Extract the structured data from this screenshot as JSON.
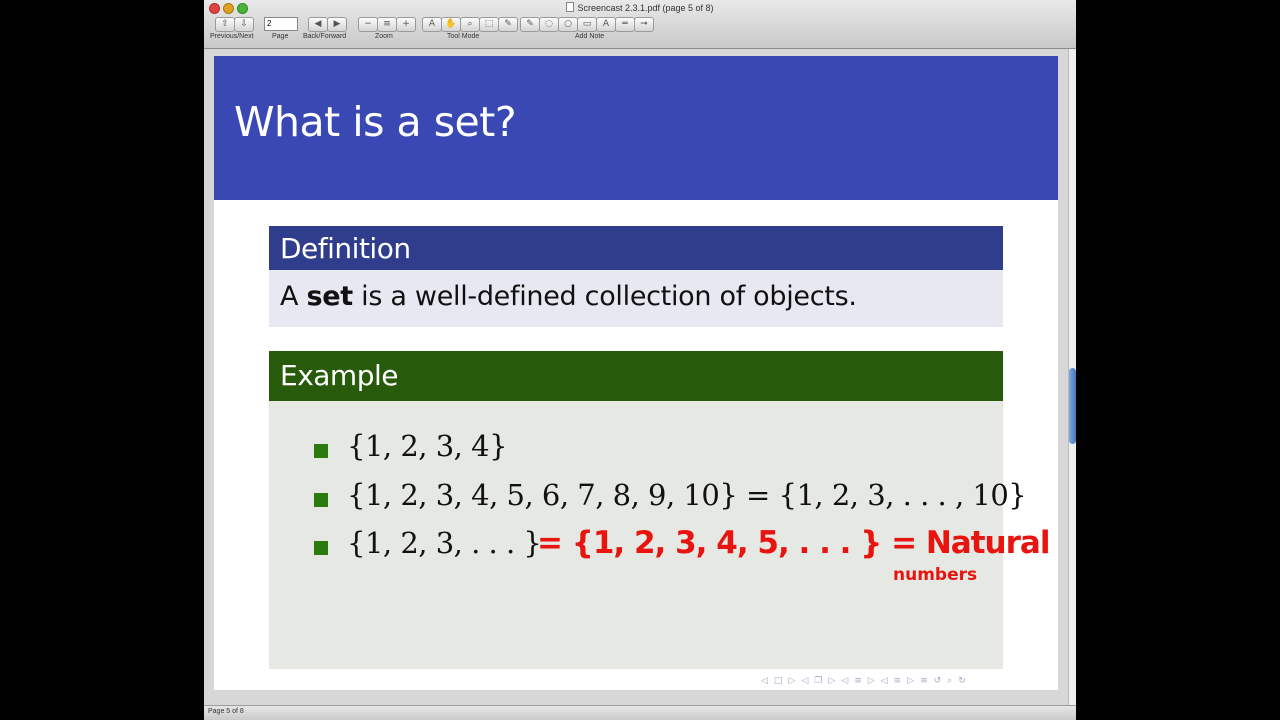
{
  "window": {
    "title": "Screencast 2.3.1.pdf (page 5 of 8)",
    "page_field": "2",
    "status": "Page 5 of 8"
  },
  "toolbar": {
    "labels": {
      "prev_next": "Previous/Next",
      "page": "Page",
      "back_forward": "Back/Forward",
      "zoom": "Zoom",
      "tool_mode": "Tool Mode",
      "add_note": "Add Note"
    },
    "icons": {
      "prev": "⇧",
      "next": "⇩",
      "back": "◀",
      "forward": "▶",
      "zoom_out": "−",
      "zoom_fit": "≡",
      "zoom_in": "+",
      "text_tool": "A",
      "move_tool": "✋",
      "zoom_tool": "⌕",
      "select_tool": "⬚",
      "pen_tool": "✎",
      "note_text": "✎",
      "note_callout": "◌",
      "note_oval": "○",
      "note_rect": "▭",
      "note_highlight": "A",
      "note_strike": "═",
      "note_arrow": "➞"
    }
  },
  "slide": {
    "title": "What is a set?",
    "definition": {
      "heading": "Definition",
      "prefix": "A ",
      "bold": "set",
      "suffix": " is a well-defined collection of objects."
    },
    "example": {
      "heading": "Example",
      "items": [
        "{1, 2, 3, 4}",
        "{1, 2, 3, 4, 5, 6, 7, 8, 9, 10} = {1, 2, 3, . . . , 10}",
        "{1, 2, 3, . . . }"
      ]
    },
    "annotation": {
      "line1": "= {1, 2, 3, 4, 5, . . . } = Natural",
      "line2": "numbers"
    },
    "nav_icons": [
      "◁",
      "□",
      "▷",
      "◁",
      "❐",
      "▷",
      "◁",
      "≡",
      "▷",
      "◁",
      "≡",
      "▷",
      "≡",
      "↺",
      "⌕",
      "↻"
    ]
  },
  "colors": {
    "header_blue": "#3a48b4",
    "definition_blue": "#303c8c",
    "example_green": "#275b0b",
    "annotation_red": "#e8140f"
  }
}
